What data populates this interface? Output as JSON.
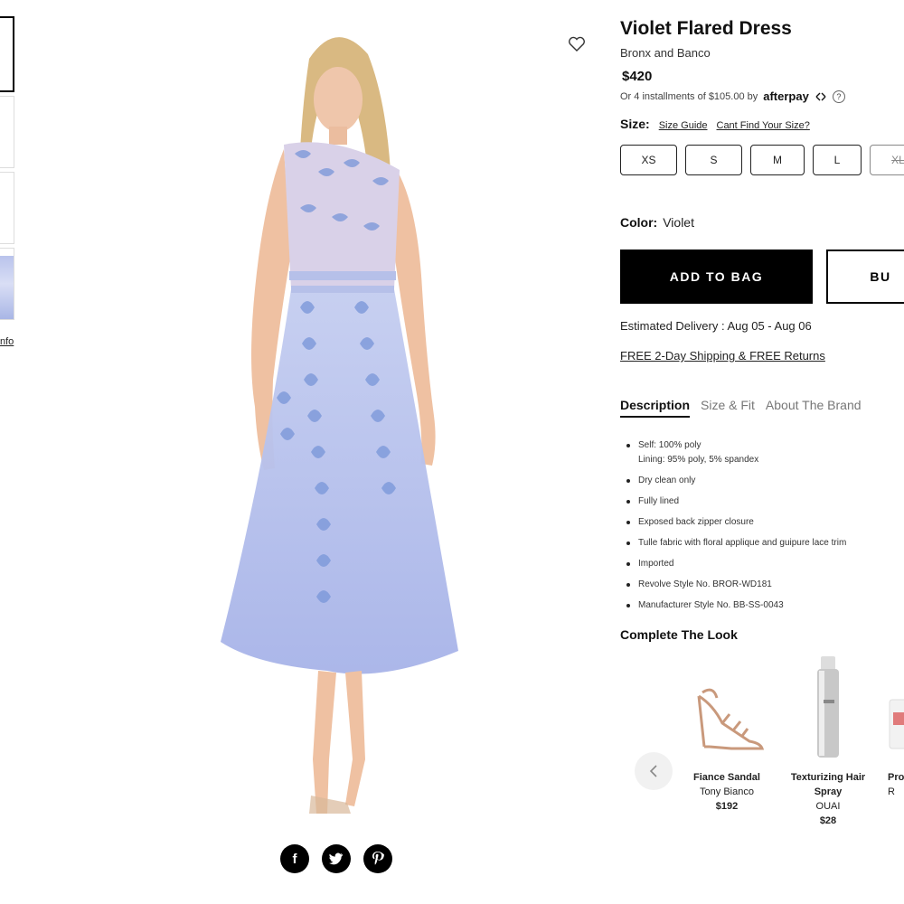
{
  "thumbnails": {
    "more_info_label": "nfo"
  },
  "product": {
    "title": "Violet Flared Dress",
    "brand": "Bronx and Banco",
    "price": "$420",
    "afterpay_text": "Or 4 installments of $105.00 by",
    "afterpay_logo": "afterpay",
    "size_label": "Size:",
    "size_guide": "Size Guide",
    "cant_find_size": "Cant Find Your Size?",
    "sizes": [
      "XS",
      "S",
      "M",
      "L",
      "XL"
    ],
    "color_label": "Color:",
    "color_value": "Violet",
    "add_to_bag": "ADD TO BAG",
    "buy_now": "BU",
    "delivery": "Estimated Delivery : Aug 05 - Aug 06",
    "shipping": "FREE 2-Day Shipping & FREE Returns"
  },
  "tabs": [
    "Description",
    "Size & Fit",
    "About The Brand"
  ],
  "description": [
    "Self: 100% poly",
    "Lining: 95% poly, 5% spandex",
    "Dry clean only",
    "Fully lined",
    "Exposed back zipper closure",
    "Tulle fabric with floral applique and guipure lace trim",
    "Imported",
    "Revolve Style No. BROR-WD181",
    "Manufacturer Style No. BB-SS-0043"
  ],
  "complete_the_look": {
    "title": "Complete The Look",
    "items": [
      {
        "name": "Fiance Sandal",
        "brand": "Tony Bianco",
        "price": "$192"
      },
      {
        "name": "Texturizing Hair Spray",
        "brand": "OUAI",
        "price": "$28"
      },
      {
        "name": "Pro",
        "brand": "R"
      }
    ]
  },
  "share": {
    "facebook": "f",
    "twitter": "t",
    "pinterest": "p"
  },
  "colors": {
    "dress": "#aab6e8",
    "lace": "#6f8fd4",
    "black": "#000000"
  }
}
